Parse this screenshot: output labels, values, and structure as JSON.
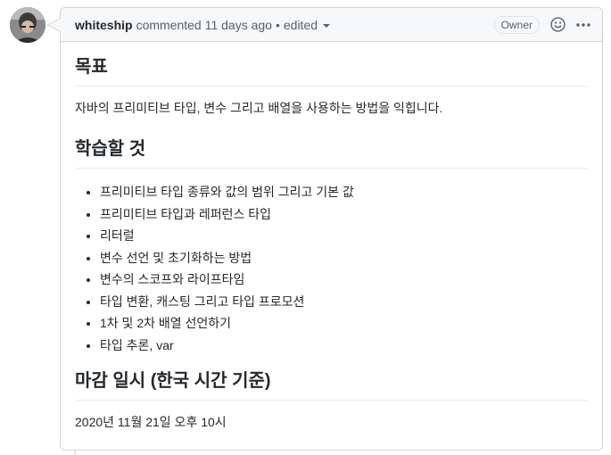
{
  "comment": {
    "author": "whiteship",
    "action": "commented",
    "time_ago": "11 days ago",
    "separator": "•",
    "edited_label": "edited",
    "badge": "Owner"
  },
  "icons": {
    "reaction": "smiley-icon",
    "more": "kebab-horizontal-icon",
    "edited_dropdown": "triangle-down-icon"
  },
  "body": {
    "goal_heading": "목표",
    "goal_text": "자바의 프리미티브 타입, 변수 그리고 배열을 사용하는 방법을 익힙니다.",
    "study_heading": "학습할 것",
    "study_items": [
      "프리미티브 타입 종류와 값의 범위 그리고 기본 값",
      "프리미티브 타입과 레퍼런스 타입",
      "리터럴",
      "변수 선언 및 초기화하는 방법",
      "변수의 스코프와 라이프타임",
      "타입 변환, 캐스팅 그리고 타입 프로모션",
      "1차 및 2차 배열 선언하기",
      "타입 추론, var"
    ],
    "deadline_heading": "마감 일시 (한국 시간 기준)",
    "deadline_text": "2020년 11월 21일 오후 10시"
  },
  "colors": {
    "header_bg": "#f6f8fa",
    "border": "#d1d5da",
    "text": "#24292e",
    "muted": "#586069"
  }
}
